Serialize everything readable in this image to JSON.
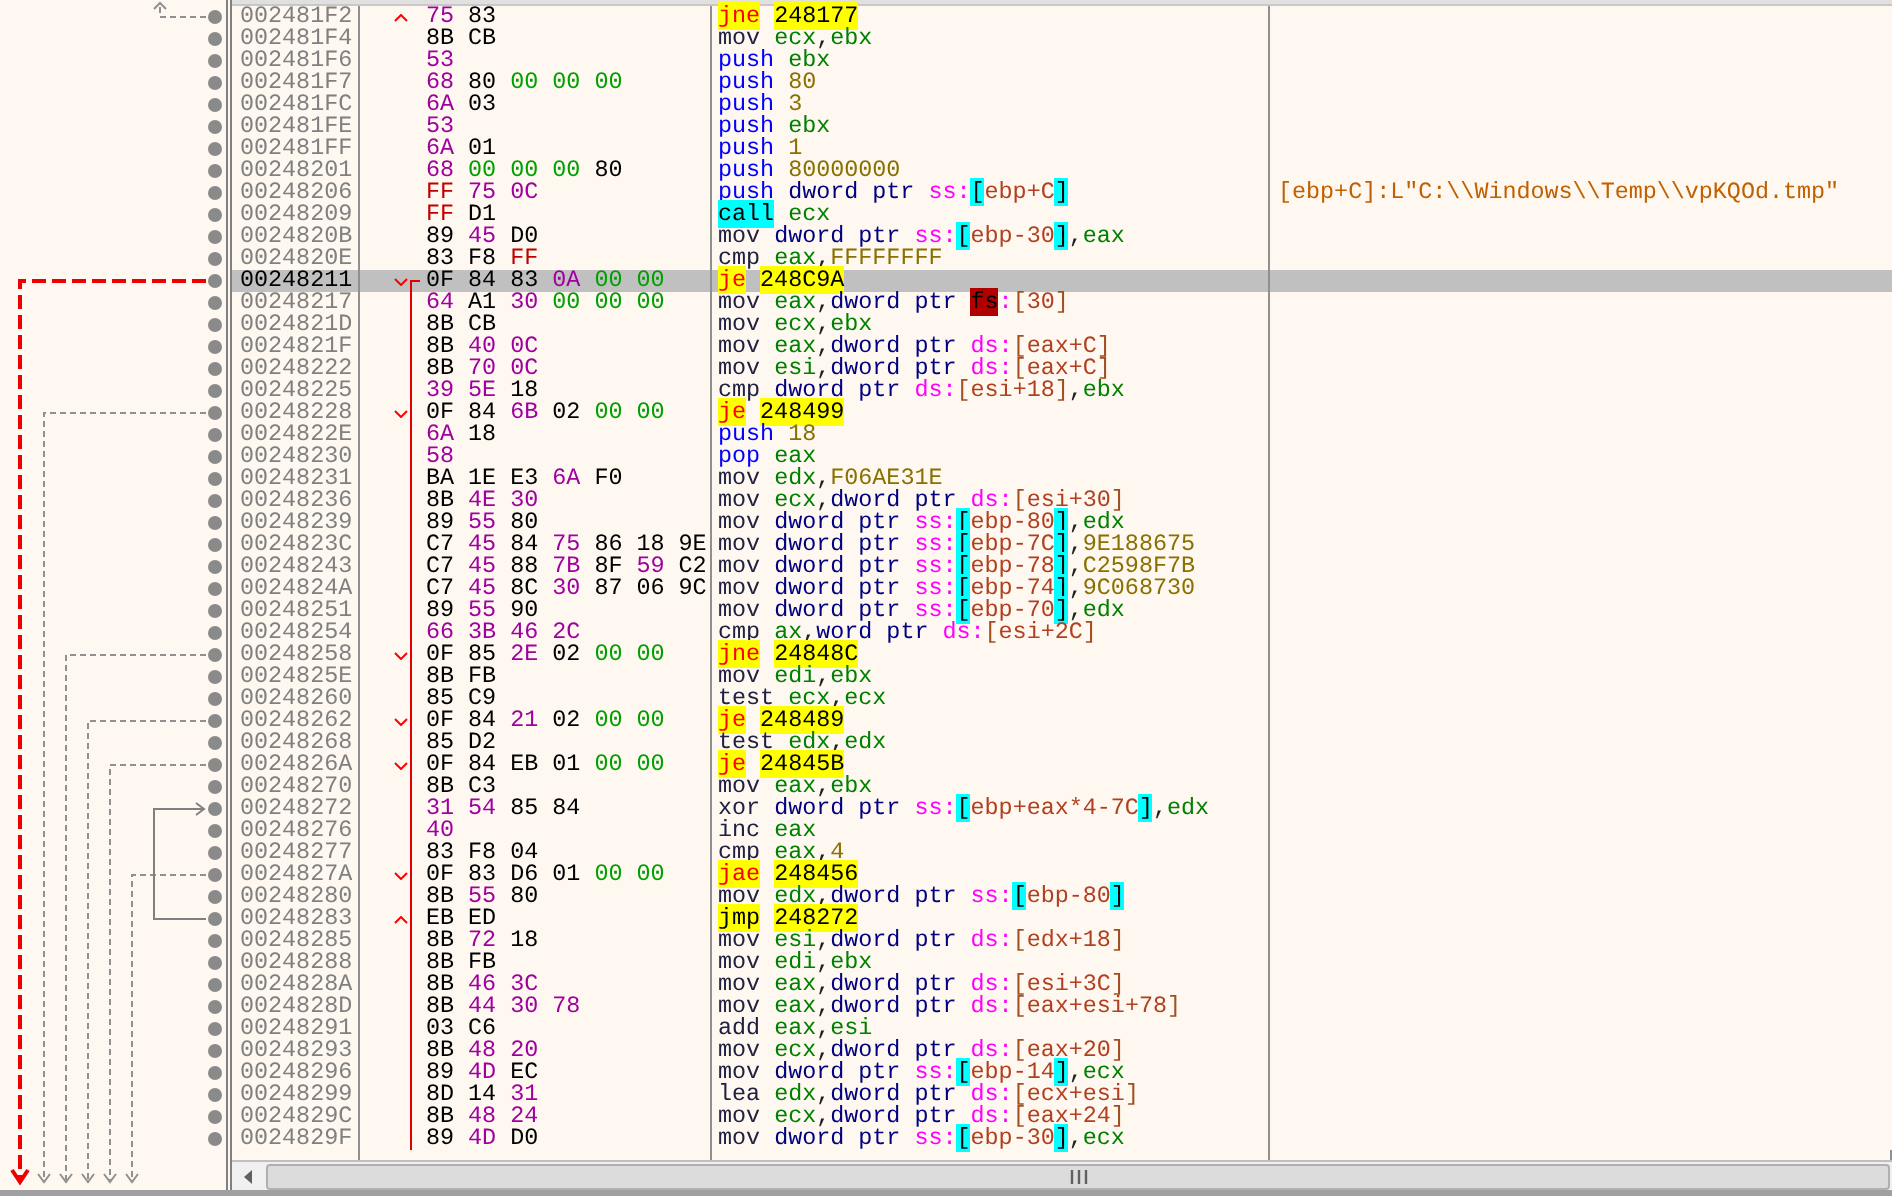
{
  "rows": [
    {
      "address": "002481F2",
      "bytes": "75 83",
      "instruction": "jne 248177",
      "kind": "branch",
      "backward": true,
      "selected": false
    },
    {
      "address": "002481F4",
      "bytes": "8B CB",
      "instruction": "mov ecx,ebx",
      "kind": "op",
      "selected": false
    },
    {
      "address": "002481F6",
      "bytes": "53",
      "instruction": "push ebx",
      "kind": "stack",
      "selected": false
    },
    {
      "address": "002481F7",
      "bytes": "68 80 00 00 00",
      "instruction": "push 80",
      "kind": "stack",
      "selected": false
    },
    {
      "address": "002481FC",
      "bytes": "6A 03",
      "instruction": "push 3",
      "kind": "stack",
      "selected": false
    },
    {
      "address": "002481FE",
      "bytes": "53",
      "instruction": "push ebx",
      "kind": "stack",
      "selected": false
    },
    {
      "address": "002481FF",
      "bytes": "6A 01",
      "instruction": "push 1",
      "kind": "stack",
      "selected": false
    },
    {
      "address": "00248201",
      "bytes": "68 00 00 00 80",
      "instruction": "push 80000000",
      "kind": "stack",
      "selected": false
    },
    {
      "address": "00248206",
      "bytes": "FF 75 0C",
      "instruction": "push dword ptr ss:[ebp+C]",
      "kind": "stack",
      "selected": false,
      "comment": "[ebp+C]:L\"C:\\\\Windows\\\\Temp\\\\vpKQOd.tmp\""
    },
    {
      "address": "00248209",
      "bytes": "FF D1",
      "instruction": "call ecx",
      "kind": "call",
      "selected": false
    },
    {
      "address": "0024820B",
      "bytes": "89 45 D0",
      "instruction": "mov dword ptr ss:[ebp-30],eax",
      "kind": "op",
      "selected": false
    },
    {
      "address": "0024820E",
      "bytes": "83 F8 FF",
      "instruction": "cmp eax,FFFFFFFF",
      "kind": "op",
      "selected": false
    },
    {
      "address": "00248211",
      "bytes": "0F 84 83 0A 00 00",
      "instruction": "je 248C9A",
      "kind": "branch",
      "backward": false,
      "selected": true
    },
    {
      "address": "00248217",
      "bytes": "64 A1 30 00 00 00",
      "instruction": "mov eax,dword ptr fs:[30]",
      "kind": "op",
      "selected": false
    },
    {
      "address": "0024821D",
      "bytes": "8B CB",
      "instruction": "mov ecx,ebx",
      "kind": "op",
      "selected": false
    },
    {
      "address": "0024821F",
      "bytes": "8B 40 0C",
      "instruction": "mov eax,dword ptr ds:[eax+C]",
      "kind": "op",
      "selected": false
    },
    {
      "address": "00248222",
      "bytes": "8B 70 0C",
      "instruction": "mov esi,dword ptr ds:[eax+C]",
      "kind": "op",
      "selected": false
    },
    {
      "address": "00248225",
      "bytes": "39 5E 18",
      "instruction": "cmp dword ptr ds:[esi+18],ebx",
      "kind": "op",
      "selected": false
    },
    {
      "address": "00248228",
      "bytes": "0F 84 6B 02 00 00",
      "instruction": "je 248499",
      "kind": "branch",
      "backward": false,
      "selected": false
    },
    {
      "address": "0024822E",
      "bytes": "6A 18",
      "instruction": "push 18",
      "kind": "stack",
      "selected": false
    },
    {
      "address": "00248230",
      "bytes": "58",
      "instruction": "pop eax",
      "kind": "stack",
      "selected": false
    },
    {
      "address": "00248231",
      "bytes": "BA 1E E3 6A F0",
      "instruction": "mov edx,F06AE31E",
      "kind": "op",
      "selected": false
    },
    {
      "address": "00248236",
      "bytes": "8B 4E 30",
      "instruction": "mov ecx,dword ptr ds:[esi+30]",
      "kind": "op",
      "selected": false
    },
    {
      "address": "00248239",
      "bytes": "89 55 80",
      "instruction": "mov dword ptr ss:[ebp-80],edx",
      "kind": "op",
      "selected": false
    },
    {
      "address": "0024823C",
      "bytes": "C7 45 84 75 86 18 9E",
      "instruction": "mov dword ptr ss:[ebp-7C],9E188675",
      "kind": "op",
      "selected": false
    },
    {
      "address": "00248243",
      "bytes": "C7 45 88 7B 8F 59 C2",
      "instruction": "mov dword ptr ss:[ebp-78],C2598F7B",
      "kind": "op",
      "selected": false
    },
    {
      "address": "0024824A",
      "bytes": "C7 45 8C 30 87 06 9C",
      "instruction": "mov dword ptr ss:[ebp-74],9C068730",
      "kind": "op",
      "selected": false
    },
    {
      "address": "00248251",
      "bytes": "89 55 90",
      "instruction": "mov dword ptr ss:[ebp-70],edx",
      "kind": "op",
      "selected": false
    },
    {
      "address": "00248254",
      "bytes": "66 3B 46 2C",
      "instruction": "cmp ax,word ptr ds:[esi+2C]",
      "kind": "op",
      "selected": false
    },
    {
      "address": "00248258",
      "bytes": "0F 85 2E 02 00 00",
      "instruction": "jne 24848C",
      "kind": "branch",
      "backward": false,
      "selected": false
    },
    {
      "address": "0024825E",
      "bytes": "8B FB",
      "instruction": "mov edi,ebx",
      "kind": "op",
      "selected": false
    },
    {
      "address": "00248260",
      "bytes": "85 C9",
      "instruction": "test ecx,ecx",
      "kind": "op",
      "selected": false
    },
    {
      "address": "00248262",
      "bytes": "0F 84 21 02 00 00",
      "instruction": "je 248489",
      "kind": "branch",
      "backward": false,
      "selected": false
    },
    {
      "address": "00248268",
      "bytes": "85 D2",
      "instruction": "test edx,edx",
      "kind": "op",
      "selected": false
    },
    {
      "address": "0024826A",
      "bytes": "0F 84 EB 01 00 00",
      "instruction": "je 24845B",
      "kind": "branch",
      "backward": false,
      "selected": false
    },
    {
      "address": "00248270",
      "bytes": "8B C3",
      "instruction": "mov eax,ebx",
      "kind": "op",
      "selected": false
    },
    {
      "address": "00248272",
      "bytes": "31 54 85 84",
      "instruction": "xor dword ptr ss:[ebp+eax*4-7C],edx",
      "kind": "op",
      "selected": false
    },
    {
      "address": "00248276",
      "bytes": "40",
      "instruction": "inc eax",
      "kind": "op",
      "selected": false
    },
    {
      "address": "00248277",
      "bytes": "83 F8 04",
      "instruction": "cmp eax,4",
      "kind": "op",
      "selected": false
    },
    {
      "address": "0024827A",
      "bytes": "0F 83 D6 01 00 00",
      "instruction": "jae 248456",
      "kind": "branch",
      "backward": false,
      "selected": false
    },
    {
      "address": "00248280",
      "bytes": "8B 55 80",
      "instruction": "mov edx,dword ptr ss:[ebp-80]",
      "kind": "op",
      "selected": false
    },
    {
      "address": "00248283",
      "bytes": "EB ED",
      "instruction": "jmp 248272",
      "kind": "jump",
      "backward": true,
      "selected": false
    },
    {
      "address": "00248285",
      "bytes": "8B 72 18",
      "instruction": "mov esi,dword ptr ds:[edx+18]",
      "kind": "op",
      "selected": false
    },
    {
      "address": "00248288",
      "bytes": "8B FB",
      "instruction": "mov edi,ebx",
      "kind": "op",
      "selected": false
    },
    {
      "address": "0024828A",
      "bytes": "8B 46 3C",
      "instruction": "mov eax,dword ptr ds:[esi+3C]",
      "kind": "op",
      "selected": false
    },
    {
      "address": "0024828D",
      "bytes": "8B 44 30 78",
      "instruction": "mov eax,dword ptr ds:[eax+esi+78]",
      "kind": "op",
      "selected": false
    },
    {
      "address": "00248291",
      "bytes": "03 C6",
      "instruction": "add eax,esi",
      "kind": "op",
      "selected": false
    },
    {
      "address": "00248293",
      "bytes": "8B 48 20",
      "instruction": "mov ecx,dword ptr ds:[eax+20]",
      "kind": "op",
      "selected": false
    },
    {
      "address": "00248296",
      "bytes": "89 4D EC",
      "instruction": "mov dword ptr ss:[ebp-14],ecx",
      "kind": "op",
      "selected": false
    },
    {
      "address": "00248299",
      "bytes": "8D 14 31",
      "instruction": "lea edx,dword ptr ds:[ecx+esi]",
      "kind": "op",
      "selected": false
    },
    {
      "address": "0024829C",
      "bytes": "8B 48 24",
      "instruction": "mov ecx,dword ptr ds:[eax+24]",
      "kind": "op",
      "selected": false
    },
    {
      "address": "0024829F",
      "bytes": "89 4D D0",
      "instruction": "mov dword ptr ss:[ebp-30],ecx",
      "kind": "op",
      "selected": false
    }
  ]
}
